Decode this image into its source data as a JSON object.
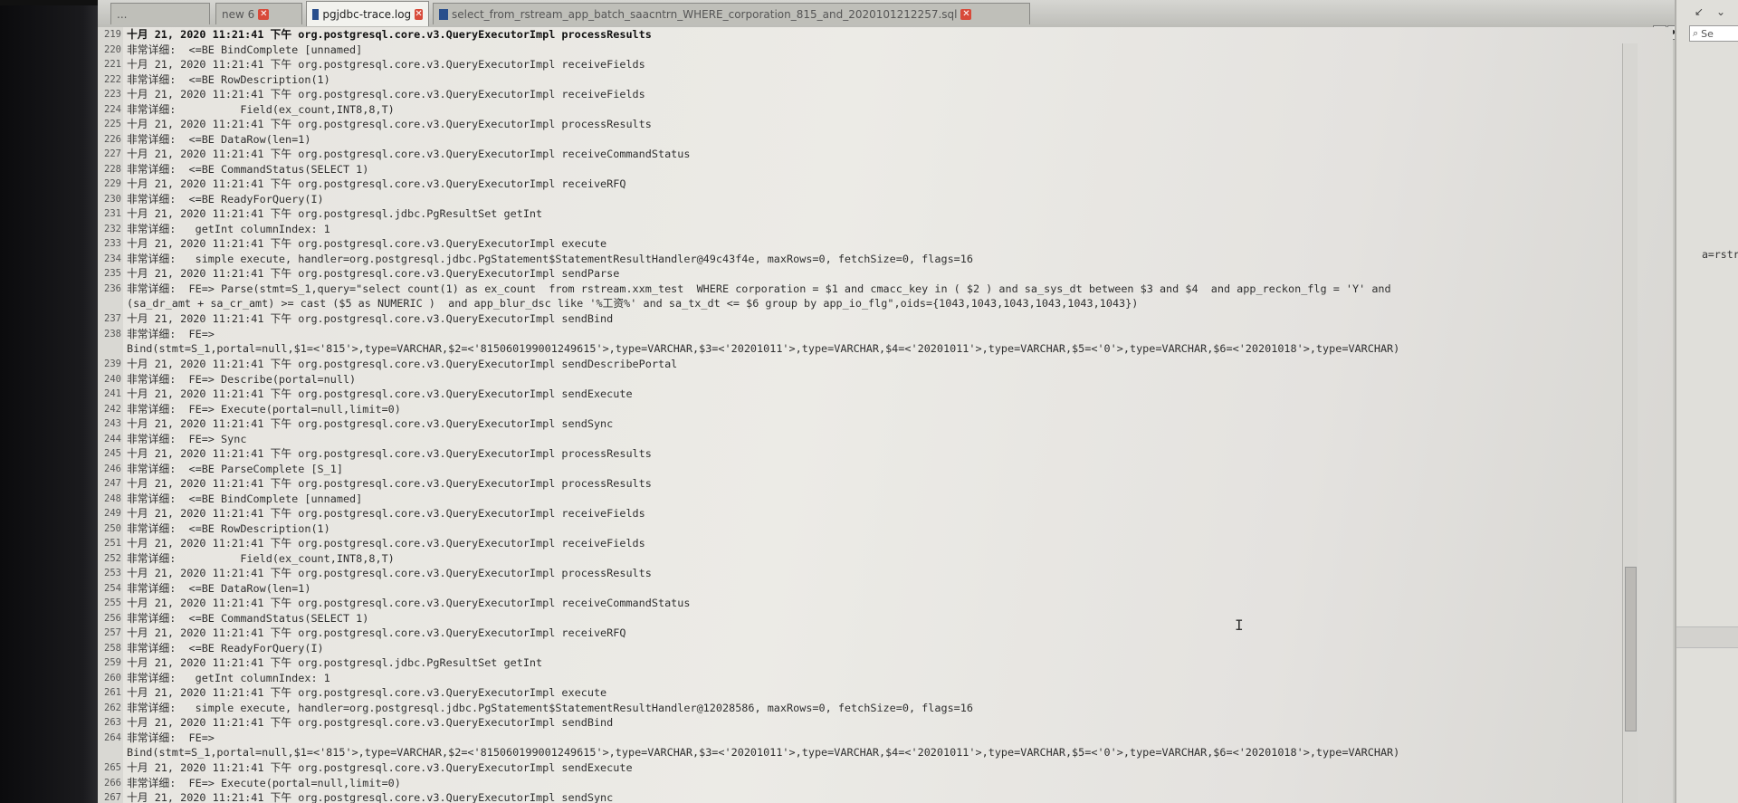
{
  "tabs": [
    {
      "label": "...",
      "active": false
    },
    {
      "label": "new 6",
      "active": false
    },
    {
      "label": "pgjdbc-trace.log",
      "active": true
    },
    {
      "label": "select_from_rstream_app_batch_saacntrn_WHERE_corporation_815_and_2020101212257.sql",
      "active": false
    }
  ],
  "tab_nav": {
    "left": "◀",
    "right": "▶",
    "close": "✕"
  },
  "right_panel": {
    "search_label": "Se",
    "snippet": "a=rstream&"
  },
  "log_lines": [
    {
      "no": "219",
      "text": "十月 21, 2020 11:21:41 下午 org.postgresql.core.v3.QueryExecutorImpl processResults"
    },
    {
      "no": "220",
      "text": "非常详细:  <=BE BindComplete [unnamed]"
    },
    {
      "no": "221",
      "text": "十月 21, 2020 11:21:41 下午 org.postgresql.core.v3.QueryExecutorImpl receiveFields"
    },
    {
      "no": "222",
      "text": "非常详细:  <=BE RowDescription(1)"
    },
    {
      "no": "223",
      "text": "十月 21, 2020 11:21:41 下午 org.postgresql.core.v3.QueryExecutorImpl receiveFields"
    },
    {
      "no": "224",
      "text": "非常详细:          Field(ex_count,INT8,8,T)"
    },
    {
      "no": "225",
      "text": "十月 21, 2020 11:21:41 下午 org.postgresql.core.v3.QueryExecutorImpl processResults"
    },
    {
      "no": "226",
      "text": "非常详细:  <=BE DataRow(len=1)"
    },
    {
      "no": "227",
      "text": "十月 21, 2020 11:21:41 下午 org.postgresql.core.v3.QueryExecutorImpl receiveCommandStatus"
    },
    {
      "no": "228",
      "text": "非常详细:  <=BE CommandStatus(SELECT 1)"
    },
    {
      "no": "229",
      "text": "十月 21, 2020 11:21:41 下午 org.postgresql.core.v3.QueryExecutorImpl receiveRFQ"
    },
    {
      "no": "230",
      "text": "非常详细:  <=BE ReadyForQuery(I)"
    },
    {
      "no": "231",
      "text": "十月 21, 2020 11:21:41 下午 org.postgresql.jdbc.PgResultSet getInt"
    },
    {
      "no": "232",
      "text": "非常详细:   getInt columnIndex: 1"
    },
    {
      "no": "233",
      "text": "十月 21, 2020 11:21:41 下午 org.postgresql.core.v3.QueryExecutorImpl execute"
    },
    {
      "no": "234",
      "text": "非常详细:   simple execute, handler=org.postgresql.jdbc.PgStatement$StatementResultHandler@49c43f4e, maxRows=0, fetchSize=0, flags=16"
    },
    {
      "no": "235",
      "text": "十月 21, 2020 11:21:41 下午 org.postgresql.core.v3.QueryExecutorImpl sendParse"
    },
    {
      "no": "236",
      "text": "非常详细:  FE=> Parse(stmt=S_1,query=\"select count(1) as ex_count  from rstream.xxm_test  WHERE corporation = $1 and cmacc_key in ( $2 ) and sa_sys_dt between $3 and $4  and app_reckon_flg = 'Y' and"
    },
    {
      "no": "",
      "text": "(sa_dr_amt + sa_cr_amt) >= cast ($5 as NUMERIC )  and app_blur_dsc like '%工资%' and sa_tx_dt <= $6 group by app_io_flg\",oids={1043,1043,1043,1043,1043,1043})"
    },
    {
      "no": "237",
      "text": "十月 21, 2020 11:21:41 下午 org.postgresql.core.v3.QueryExecutorImpl sendBind"
    },
    {
      "no": "238",
      "text": "非常详细:  FE=>"
    },
    {
      "no": "",
      "text": "Bind(stmt=S_1,portal=null,$1=<'815'>,type=VARCHAR,$2=<'815060199001249615'>,type=VARCHAR,$3=<'20201011'>,type=VARCHAR,$4=<'20201011'>,type=VARCHAR,$5=<'0'>,type=VARCHAR,$6=<'20201018'>,type=VARCHAR)"
    },
    {
      "no": "239",
      "text": "十月 21, 2020 11:21:41 下午 org.postgresql.core.v3.QueryExecutorImpl sendDescribePortal"
    },
    {
      "no": "240",
      "text": "非常详细:  FE=> Describe(portal=null)"
    },
    {
      "no": "241",
      "text": "十月 21, 2020 11:21:41 下午 org.postgresql.core.v3.QueryExecutorImpl sendExecute"
    },
    {
      "no": "242",
      "text": "非常详细:  FE=> Execute(portal=null,limit=0)"
    },
    {
      "no": "243",
      "text": "十月 21, 2020 11:21:41 下午 org.postgresql.core.v3.QueryExecutorImpl sendSync"
    },
    {
      "no": "244",
      "text": "非常详细:  FE=> Sync"
    },
    {
      "no": "245",
      "text": "十月 21, 2020 11:21:41 下午 org.postgresql.core.v3.QueryExecutorImpl processResults"
    },
    {
      "no": "246",
      "text": "非常详细:  <=BE ParseComplete [S_1]"
    },
    {
      "no": "247",
      "text": "十月 21, 2020 11:21:41 下午 org.postgresql.core.v3.QueryExecutorImpl processResults"
    },
    {
      "no": "248",
      "text": "非常详细:  <=BE BindComplete [unnamed]"
    },
    {
      "no": "249",
      "text": "十月 21, 2020 11:21:41 下午 org.postgresql.core.v3.QueryExecutorImpl receiveFields"
    },
    {
      "no": "250",
      "text": "非常详细:  <=BE RowDescription(1)"
    },
    {
      "no": "251",
      "text": "十月 21, 2020 11:21:41 下午 org.postgresql.core.v3.QueryExecutorImpl receiveFields"
    },
    {
      "no": "252",
      "text": "非常详细:          Field(ex_count,INT8,8,T)"
    },
    {
      "no": "253",
      "text": "十月 21, 2020 11:21:41 下午 org.postgresql.core.v3.QueryExecutorImpl processResults"
    },
    {
      "no": "254",
      "text": "非常详细:  <=BE DataRow(len=1)"
    },
    {
      "no": "255",
      "text": "十月 21, 2020 11:21:41 下午 org.postgresql.core.v3.QueryExecutorImpl receiveCommandStatus"
    },
    {
      "no": "256",
      "text": "非常详细:  <=BE CommandStatus(SELECT 1)"
    },
    {
      "no": "257",
      "text": "十月 21, 2020 11:21:41 下午 org.postgresql.core.v3.QueryExecutorImpl receiveRFQ"
    },
    {
      "no": "258",
      "text": "非常详细:  <=BE ReadyForQuery(I)"
    },
    {
      "no": "259",
      "text": "十月 21, 2020 11:21:41 下午 org.postgresql.jdbc.PgResultSet getInt"
    },
    {
      "no": "260",
      "text": "非常详细:   getInt columnIndex: 1"
    },
    {
      "no": "261",
      "text": "十月 21, 2020 11:21:41 下午 org.postgresql.core.v3.QueryExecutorImpl execute"
    },
    {
      "no": "262",
      "text": "非常详细:   simple execute, handler=org.postgresql.jdbc.PgStatement$StatementResultHandler@12028586, maxRows=0, fetchSize=0, flags=16"
    },
    {
      "no": "263",
      "text": "十月 21, 2020 11:21:41 下午 org.postgresql.core.v3.QueryExecutorImpl sendBind"
    },
    {
      "no": "264",
      "text": "非常详细:  FE=>"
    },
    {
      "no": "",
      "text": "Bind(stmt=S_1,portal=null,$1=<'815'>,type=VARCHAR,$2=<'815060199001249615'>,type=VARCHAR,$3=<'20201011'>,type=VARCHAR,$4=<'20201011'>,type=VARCHAR,$5=<'0'>,type=VARCHAR,$6=<'20201018'>,type=VARCHAR)"
    },
    {
      "no": "265",
      "text": "十月 21, 2020 11:21:41 下午 org.postgresql.core.v3.QueryExecutorImpl sendExecute"
    },
    {
      "no": "266",
      "text": "非常详细:  FE=> Execute(portal=null,limit=0)"
    },
    {
      "no": "267",
      "text": "十月 21, 2020 11:21:41 下午 org.postgresql.core.v3.QueryExecutorImpl sendSync"
    }
  ]
}
